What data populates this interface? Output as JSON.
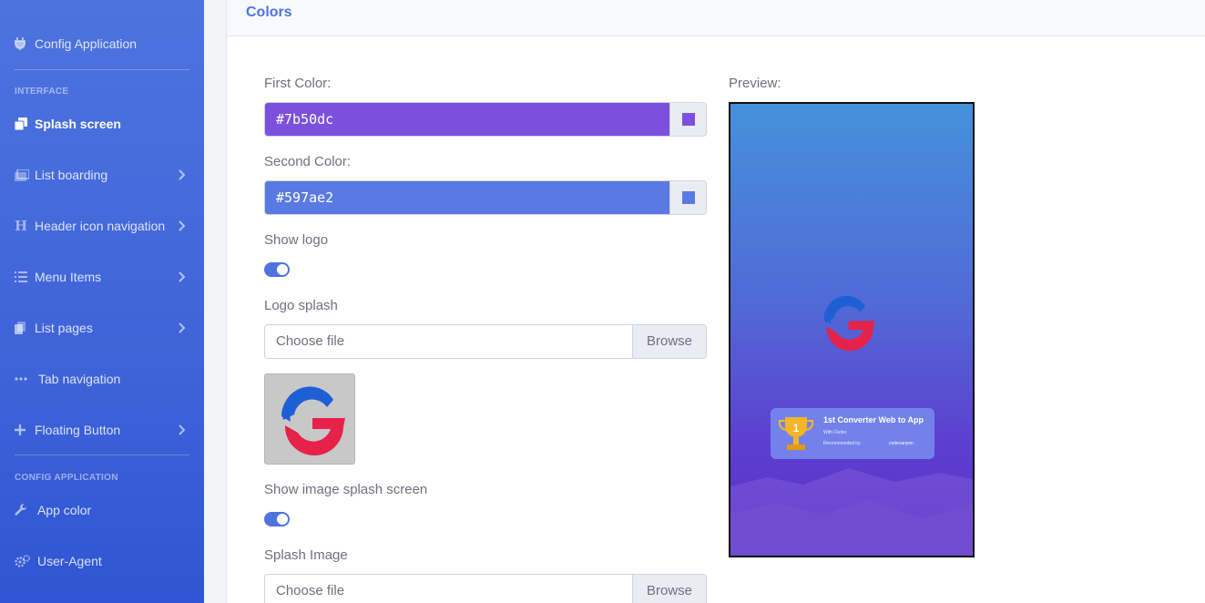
{
  "sidebar": {
    "items": [
      {
        "label": "Config Application",
        "icon": "plug-icon"
      },
      {
        "label": "Splash screen",
        "icon": "copy-icon",
        "active": true
      },
      {
        "label": "List boarding",
        "icon": "images-icon"
      },
      {
        "label": "Header icon navigation",
        "icon": "heading-icon"
      },
      {
        "label": "Menu Items",
        "icon": "list-icon"
      },
      {
        "label": "List pages",
        "icon": "pages-icon"
      },
      {
        "label": "Tab navigation",
        "icon": "ellipsis-icon"
      },
      {
        "label": "Floating Button",
        "icon": "plus-icon"
      },
      {
        "label": "App color",
        "icon": "wrench-icon"
      },
      {
        "label": "User-Agent",
        "icon": "cogs-icon"
      }
    ],
    "headings": {
      "interface": "INTERFACE",
      "config": "CONFIG APPLICATION"
    }
  },
  "card": {
    "title": "Colors",
    "first_color_label": "First Color:",
    "first_color_value": "#7b50dc",
    "second_color_label": "Second Color:",
    "second_color_value": "#597ae2",
    "show_logo_label": "Show logo",
    "show_logo_on": true,
    "logo_splash_label": "Logo splash",
    "choose_file": "Choose file",
    "browse": "Browse",
    "show_image_label": "Show image splash screen",
    "show_image_on": true,
    "splash_image_label": "Splash Image",
    "preview_label": "Preview:"
  },
  "preview_badge": {
    "title": "1st Converter Web to App",
    "subtitle": "With Flutter",
    "recommended": "Recommended by",
    "brand": "codecanyon"
  },
  "colors": {
    "sidebar": "#4e73df",
    "accent": "#4e73df",
    "first": "#7b50dc",
    "second": "#597ae2"
  }
}
